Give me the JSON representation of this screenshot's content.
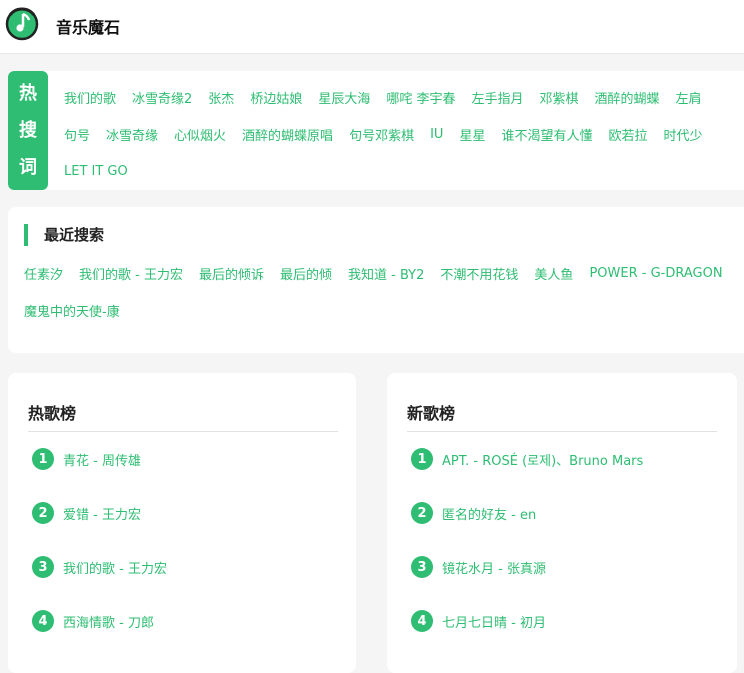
{
  "header": {
    "app_name": "音乐魔石"
  },
  "hot_search": {
    "badge": [
      "热",
      "搜",
      "词"
    ],
    "rows": [
      [
        "我们的歌",
        "冰雪奇缘2",
        "张杰",
        "桥边姑娘",
        "星辰大海",
        "哪咤 李宇春",
        "左手指月",
        "邓紫棋",
        "酒醉的蝴蝶",
        "左肩"
      ],
      [
        "句号",
        "冰雪奇缘",
        "心似烟火",
        "酒醉的蝴蝶原唱",
        "句号邓紫棋",
        "IU",
        "星星",
        "谁不渴望有人懂",
        "欧若拉",
        "时代少"
      ],
      [
        "LET IT GO"
      ]
    ]
  },
  "recent_search": {
    "title": "最近搜索",
    "rows": [
      [
        "任素汐",
        "我们的歌 - 王力宏",
        "最后的倾诉",
        "最后的倾",
        "我知道 - BY2",
        "不潮不用花钱",
        "美人鱼",
        "POWER - G-DRAGON"
      ],
      [
        "魔鬼中的天使-康"
      ]
    ]
  },
  "hot_chart": {
    "title": "热歌榜",
    "songs": [
      {
        "rank": "1",
        "text": "青花 - 周传雄"
      },
      {
        "rank": "2",
        "text": "爱错 - 王力宏"
      },
      {
        "rank": "3",
        "text": "我们的歌 - 王力宏"
      },
      {
        "rank": "4",
        "text": "西海情歌 - 刀郎"
      }
    ]
  },
  "new_chart": {
    "title": "新歌榜",
    "songs": [
      {
        "rank": "1",
        "text": "APT. - ROSÉ (로제)、Bruno Mars"
      },
      {
        "rank": "2",
        "text": "匿名的好友 - en"
      },
      {
        "rank": "3",
        "text": "镜花水月 - 张真源"
      },
      {
        "rank": "4",
        "text": "七月七日晴 - 初月"
      }
    ]
  },
  "colors": {
    "accent": "#2ebd72",
    "logo_ring": "#2ebd72",
    "logo_dark": "#222222"
  }
}
